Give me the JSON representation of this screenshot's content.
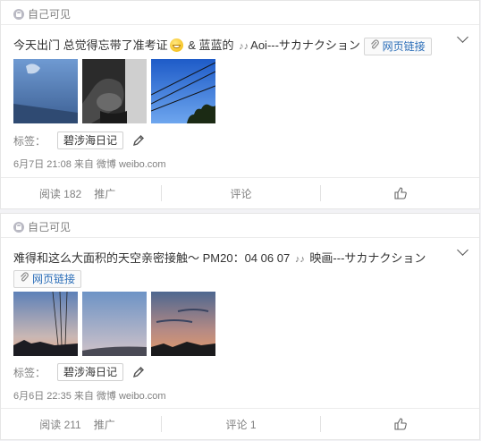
{
  "posts": [
    {
      "privacy": "自己可见",
      "text_a": "今天出门 总觉得忘带了准考证",
      "text_b": " & 蓝蓝的",
      "text_c": "Aoi---サカナクション",
      "weblink": "网页链接",
      "tags_label": "标签：",
      "tag": "碧涉海日记",
      "meta": "6月7日 21:08 来自 微博 weibo.com",
      "read": "阅读 182",
      "promote": "推广",
      "comment": "评论"
    },
    {
      "privacy": "自己可见",
      "text_a": "难得和这么大面积的天空亲密接触～ PM20：04 06 07",
      "text_b": " 映画---サカナクション",
      "weblink": "网页链接",
      "tags_label": "标签：",
      "tag": "碧涉海日记",
      "meta": "6月6日 22:35 来自 微博 weibo.com",
      "read": "阅读 211",
      "promote": "推广",
      "comment": "评论 1"
    }
  ],
  "icons": {
    "music_note": "♪♪",
    "clip": "✎",
    "emoji": "grinning-emoji-icon"
  }
}
